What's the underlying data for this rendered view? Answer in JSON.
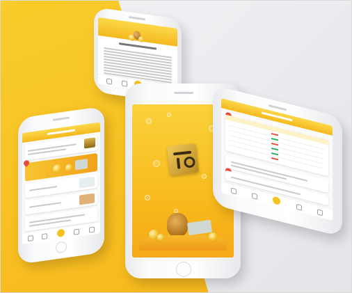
{
  "scene": {
    "colors": {
      "yellow": "#f6c21f",
      "gray_bg": "#e6e8eb",
      "phone": "#f7f8fa"
    }
  },
  "phones": {
    "top": {
      "header_title": "",
      "icons": [
        "coin-bag-icon"
      ]
    },
    "left": {
      "header_title": "",
      "section_titles": [
        "",
        "",
        ""
      ],
      "nav_icons": [
        "crown-icon",
        "hand-icon",
        "coin-button-icon",
        "person-icon",
        "list-icon"
      ]
    },
    "center": {
      "logo": "logo-icon"
    },
    "right": {
      "header_title": "",
      "table_rows": 6,
      "nav_icons": [
        "home-icon",
        "grid-icon",
        "coin-button-icon",
        "chart-icon",
        "list-icon"
      ]
    }
  }
}
